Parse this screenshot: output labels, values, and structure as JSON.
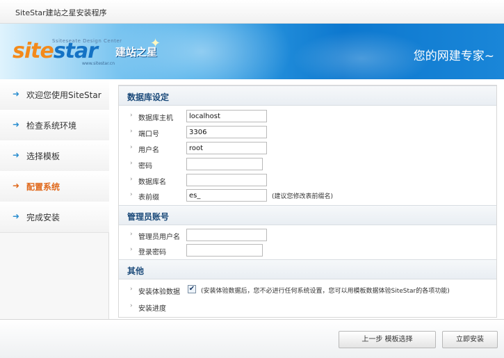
{
  "window": {
    "title": "SiteStar建站之星安装程序"
  },
  "banner": {
    "logo_text_1": "site",
    "logo_text_2": "star",
    "logo_cn": "建站之星",
    "logo_sub": "Ssiteseate Design Center",
    "logo_url": "www.sitestar.cn",
    "slogan": "您的网建专家~"
  },
  "sidebar": {
    "items": [
      {
        "label": "欢迎您使用SiteStar",
        "active": false
      },
      {
        "label": "检查系统环境",
        "active": false
      },
      {
        "label": "选择模板",
        "active": false
      },
      {
        "label": "配置系统",
        "active": true
      },
      {
        "label": "完成安装",
        "active": false
      }
    ]
  },
  "db_section": {
    "title": "数据库设定",
    "host": {
      "label": "数据库主机",
      "value": "localhost"
    },
    "port": {
      "label": "端口号",
      "value": "3306"
    },
    "user": {
      "label": "用户名",
      "value": "root"
    },
    "password": {
      "label": "密码",
      "value": ""
    },
    "dbname": {
      "label": "数据库名",
      "value": ""
    },
    "prefix": {
      "label": "表前缀",
      "value": "es_",
      "hint": "(建议您修改表前缀名)"
    }
  },
  "admin_section": {
    "title": "管理员账号",
    "username": {
      "label": "管理员用户名",
      "value": ""
    },
    "password": {
      "label": "登录密码",
      "value": ""
    }
  },
  "other_section": {
    "title": "其他",
    "demo_data": {
      "label": "安装体验数据",
      "checked": true,
      "note": "(安装体验数据后，您不必进行任何系统设置，您可以用模板数据体验SiteStar的各项功能)"
    },
    "progress": {
      "label": "安装进度"
    }
  },
  "footer": {
    "prev_label": "上一步 模板选择",
    "install_label": "立即安装"
  },
  "colors": {
    "accent_blue": "#1b4a7a",
    "active_orange": "#e06a1e",
    "arrow_blue": "#2d8fd0"
  }
}
